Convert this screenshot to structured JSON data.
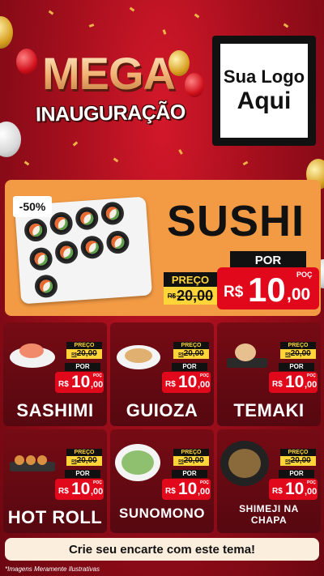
{
  "header": {
    "title_line1": "MEGA",
    "title_line2": "INAUGURAÇÃO",
    "logo_line1": "Sua Logo",
    "logo_line2": "Aqui"
  },
  "hero": {
    "discount": "-50%",
    "name": "SUSHI",
    "preco_label": "PREÇO",
    "old_prefix": "R$",
    "old_price": "20,00",
    "por_label": "POR",
    "currency": "R$",
    "price_int": "10",
    "price_dec": ",00",
    "unit": "POÇ"
  },
  "products": [
    {
      "name": "SASHIMI",
      "preco_label": "PREÇO",
      "old_prefix": "R$",
      "old_price": "20,00",
      "por_label": "POR",
      "currency": "R$",
      "price_int": "10",
      "price_dec": ",00",
      "unit": "POÇ"
    },
    {
      "name": "GUIOZA",
      "preco_label": "PREÇO",
      "old_prefix": "R$",
      "old_price": "20,00",
      "por_label": "POR",
      "currency": "R$",
      "price_int": "10",
      "price_dec": ",00",
      "unit": "POÇ"
    },
    {
      "name": "TEMAKI",
      "preco_label": "PREÇO",
      "old_prefix": "R$",
      "old_price": "20,00",
      "por_label": "POR",
      "currency": "R$",
      "price_int": "10",
      "price_dec": ",00",
      "unit": "POÇ"
    },
    {
      "name": "HOT ROLL",
      "preco_label": "PREÇO",
      "old_prefix": "R$",
      "old_price": "20,00",
      "por_label": "POR",
      "currency": "R$",
      "price_int": "10",
      "price_dec": ",00",
      "unit": "POÇ"
    },
    {
      "name": "SUNOMONO",
      "preco_label": "PREÇO",
      "old_prefix": "R$",
      "old_price": "20,00",
      "por_label": "POR",
      "currency": "R$",
      "price_int": "10",
      "price_dec": ",00",
      "unit": "POÇ"
    },
    {
      "name": "SHIMEJI NA CHAPA",
      "preco_label": "PREÇO",
      "old_prefix": "R$",
      "old_price": "20,00",
      "por_label": "POR",
      "currency": "R$",
      "price_int": "10",
      "price_dec": ",00",
      "unit": "POÇ"
    }
  ],
  "footer": {
    "cta": "Crie seu encarte com este tema!",
    "disclaimer": "*Imagens Meramente Ilustrativas"
  },
  "colors": {
    "background": "#a10e1c",
    "hero_bg": "#f29a44",
    "price_red": "#e2081c",
    "tag_yellow": "#ffd53a",
    "card_bg": "#6a0a10"
  }
}
